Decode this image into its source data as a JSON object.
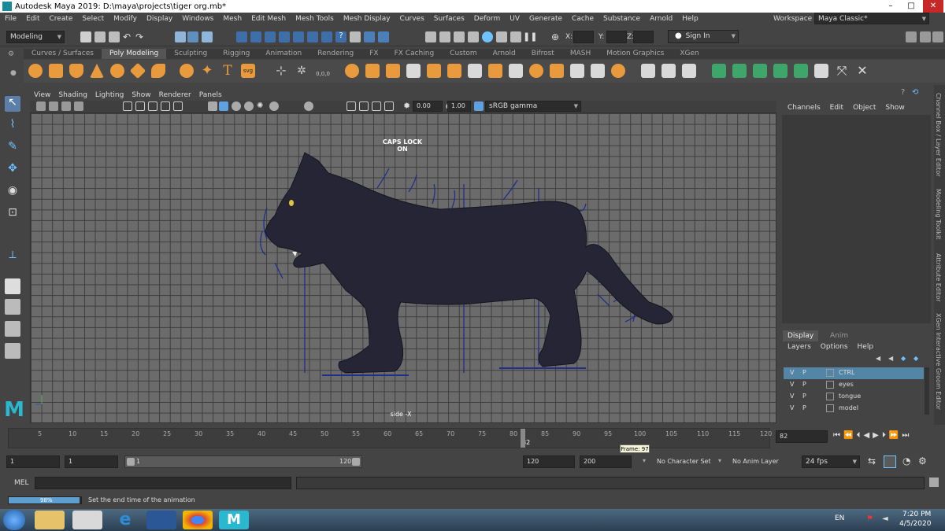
{
  "window": {
    "title": "Autodesk Maya 2019: D:\\maya\\projects\\tiger org.mb*",
    "min": "–",
    "max": "□",
    "close": "✕"
  },
  "menu": [
    "File",
    "Edit",
    "Create",
    "Select",
    "Modify",
    "Display",
    "Windows",
    "Mesh",
    "Edit Mesh",
    "Mesh Tools",
    "Mesh Display",
    "Curves",
    "Surfaces",
    "Deform",
    "UV",
    "Generate",
    "Cache",
    "Substance",
    "Arnold",
    "Help"
  ],
  "workspace": {
    "label": "Workspace :",
    "value": "Maya Classic*"
  },
  "status_line": {
    "mode": "Modeling",
    "x_label": "X:",
    "y_label": "Y:",
    "z_label": "Z:",
    "sign_in": "Sign In"
  },
  "shelf_tabs": [
    "Curves / Surfaces",
    "Poly Modeling",
    "Sculpting",
    "Rigging",
    "Animation",
    "Rendering",
    "FX",
    "FX Caching",
    "Custom",
    "Arnold",
    "Bifrost",
    "MASH",
    "Motion Graphics",
    "XGen"
  ],
  "shelf_active": 1,
  "shelf_text_icons": {
    "text_tool": "T",
    "svg_tool": "svg",
    "counter": "0,0,0"
  },
  "viewport": {
    "menu": [
      "View",
      "Shading",
      "Lighting",
      "Show",
      "Renderer",
      "Panels"
    ],
    "exposure": "0.00",
    "gamma": "1.00",
    "color_space": "sRGB gamma",
    "caps_lock": "CAPS LOCK ON",
    "camera": "side -X"
  },
  "channel_box": {
    "menu": [
      "Channels",
      "Edit",
      "Object",
      "Show"
    ]
  },
  "side_tabs": [
    "Channel Box / Layer Editor",
    "Modeling Toolkit",
    "Attribute Editor",
    "XGen Interactive Groom Editor"
  ],
  "layers": {
    "tabs": [
      "Display",
      "Anim"
    ],
    "menu": [
      "Layers",
      "Options",
      "Help"
    ],
    "rows": [
      {
        "v": "V",
        "p": "P",
        "name": "CTRL"
      },
      {
        "v": "V",
        "p": "P",
        "name": "eyes"
      },
      {
        "v": "V",
        "p": "P",
        "name": "tongue"
      },
      {
        "v": "V",
        "p": "P",
        "name": "model"
      }
    ]
  },
  "timeline": {
    "ticks": [
      "5",
      "10",
      "15",
      "20",
      "25",
      "30",
      "35",
      "40",
      "45",
      "50",
      "55",
      "60",
      "65",
      "70",
      "75",
      "80",
      "82",
      "85",
      "90",
      "95",
      "100",
      "105",
      "110",
      "115",
      "120"
    ],
    "current_frame": "82",
    "tooltip": "Frame: 97"
  },
  "range": {
    "start": "1",
    "playback_start": "1",
    "slider_start": "1",
    "slider_end": "120",
    "playback_end": "120",
    "end": "200",
    "character_set": "No Character Set",
    "anim_layer": "No Anim Layer",
    "fps": "24 fps"
  },
  "mel": {
    "label": "MEL"
  },
  "help_line": {
    "progress": "98%",
    "progress_value": 0.98,
    "text": "Set the end time of the animation"
  },
  "taskbar": {
    "lang": "EN",
    "time": "7:20 PM",
    "date": "4/5/2020"
  }
}
